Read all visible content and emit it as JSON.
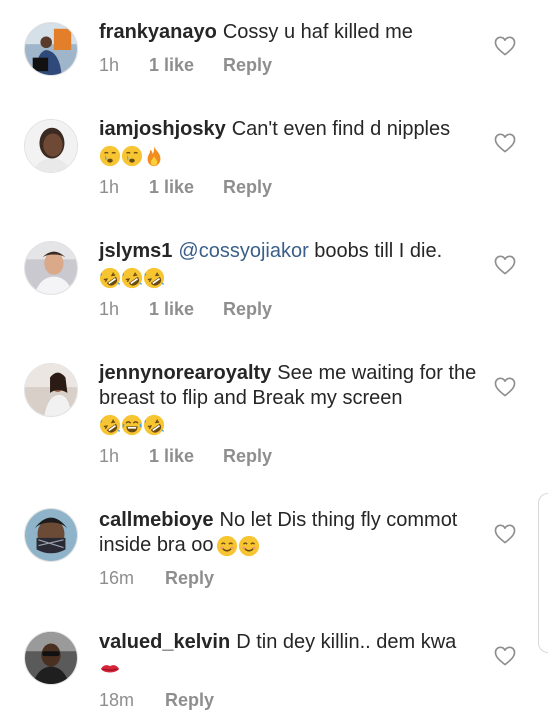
{
  "comments": [
    {
      "username": "frankyanayo",
      "text": "Cossy u haf killed me",
      "emojis": [],
      "time": "1h",
      "likes": "1 like",
      "reply": "Reply"
    },
    {
      "username": "iamjoshjosky",
      "text": "Can't even find d nipples",
      "emojis": [
        "crying-face",
        "crying-face",
        "fire"
      ],
      "time": "1h",
      "likes": "1 like",
      "reply": "Reply"
    },
    {
      "username": "jslyms1",
      "mention": "@cossyojiakor",
      "text": "boobs till I die.",
      "emojis": [
        "rofl",
        "rofl",
        "rofl"
      ],
      "time": "1h",
      "likes": "1 like",
      "reply": "Reply"
    },
    {
      "username": "jennynorearoyalty",
      "text": "See me waiting for the breast to flip and  Break my screen",
      "emojis": [
        "rofl",
        "joy",
        "rofl"
      ],
      "time": "1h",
      "likes": "1 like",
      "reply": "Reply"
    },
    {
      "username": "callmebioye",
      "text": "No let Dis thing fly commot inside bra oo",
      "emojis": [
        "smiling-face",
        "smiling-face"
      ],
      "time": "16m",
      "likes": "",
      "reply": "Reply"
    },
    {
      "username": "valued_kelvin",
      "text": "D tin dey killin.. dem kwa",
      "emojis": [
        "lips"
      ],
      "time": "18m",
      "likes": "",
      "reply": "Reply"
    }
  ],
  "icons": {
    "like": "heart-outline-icon"
  },
  "colors": {
    "text": "#262626",
    "meta": "#8e8e8e",
    "mention": "#3b5f8a"
  }
}
